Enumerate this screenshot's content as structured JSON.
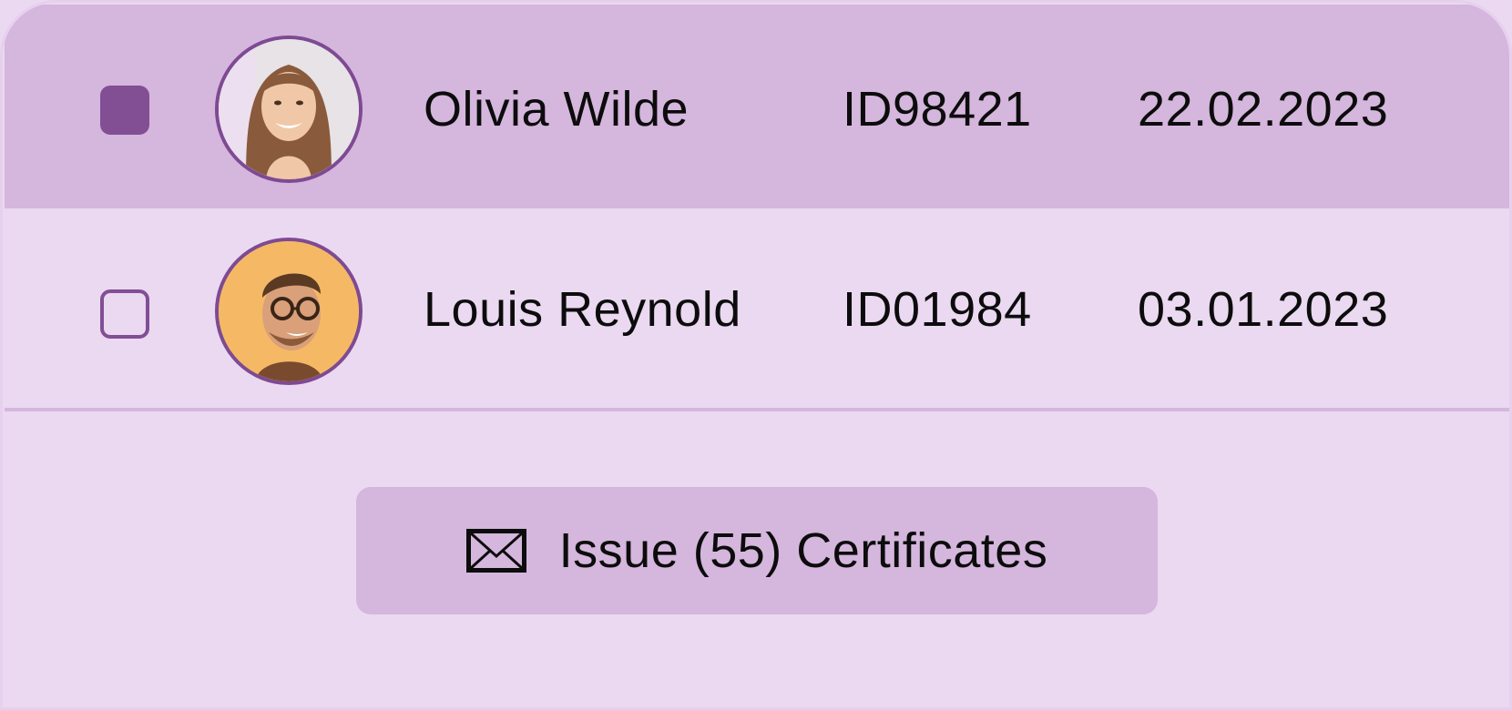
{
  "colors": {
    "row_selected_bg": "#d5b6dd",
    "row_bg": "#ead9f1",
    "accent": "#824e94",
    "text": "#0c0c0c"
  },
  "rows": [
    {
      "selected": true,
      "avatar": "avatar-woman-smiling",
      "name": "Olivia Wilde",
      "id": "ID98421",
      "date": "22.02.2023"
    },
    {
      "selected": false,
      "avatar": "avatar-man-glasses",
      "name": "Louis Reynold",
      "id": "ID01984",
      "date": "03.01.2023"
    }
  ],
  "action": {
    "icon": "envelope-icon",
    "label": "Issue (55) Certificates"
  }
}
